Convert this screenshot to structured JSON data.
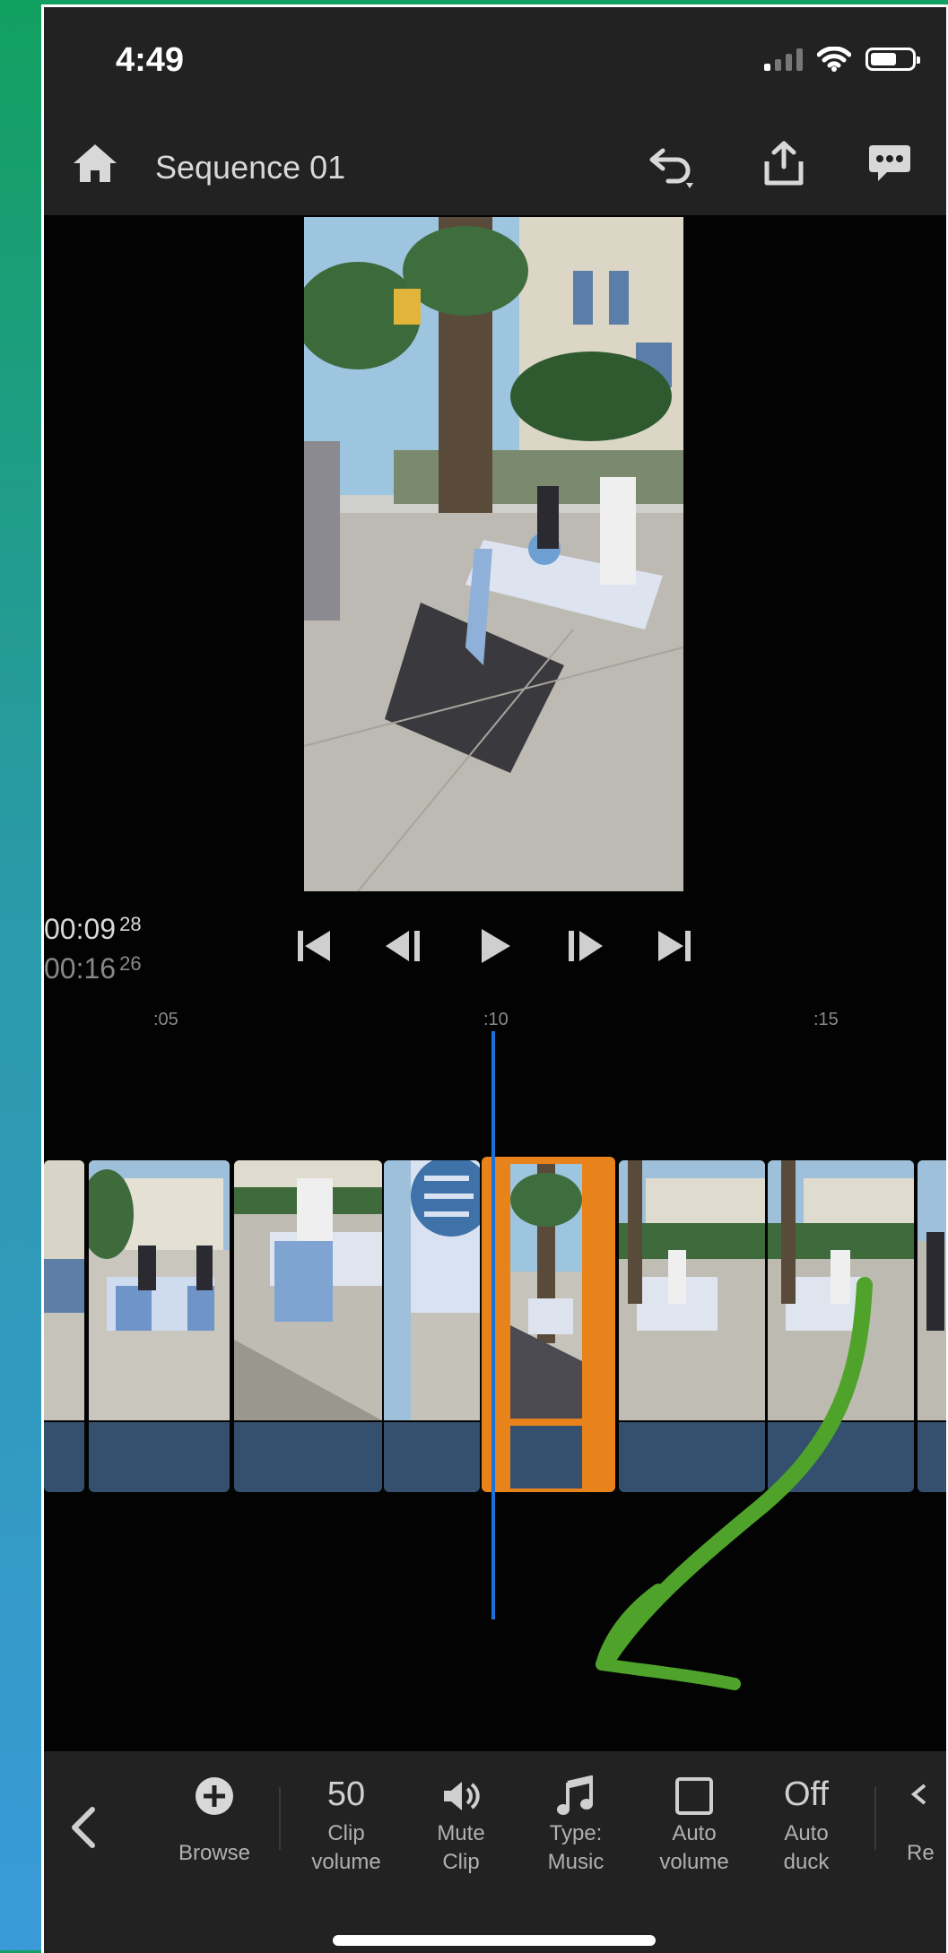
{
  "status_bar": {
    "time": "4:49"
  },
  "header": {
    "title": "Sequence 01"
  },
  "timecode": {
    "current": "00:09",
    "current_frame": "28",
    "total": "00:16",
    "total_frame": "26"
  },
  "ruler": {
    "labels": [
      ":05",
      ":10",
      ":15"
    ]
  },
  "toolbar": {
    "browse_label": "Browse",
    "clip_volume_value": "50",
    "clip_volume_label": "Clip volume",
    "mute_label": "Mute Clip",
    "type_label": "Type: Music",
    "auto_volume_label": "Auto volume",
    "auto_duck_value": "Off",
    "auto_duck_label": "Auto duck",
    "reset_label": "Re"
  },
  "colors": {
    "accent_selection": "#e8821a",
    "playhead": "#1c72d6",
    "audio_wave": "#34506e",
    "annotation_arrow": "#4fa32a"
  },
  "icons": [
    "home-icon",
    "undo-icon",
    "share-icon",
    "chat-icon",
    "skip-to-start-icon",
    "step-back-icon",
    "play-icon",
    "step-forward-icon",
    "skip-to-end-icon",
    "chevron-left-icon",
    "add-circle-icon",
    "speaker-icon",
    "music-note-icon",
    "checkbox-icon"
  ]
}
